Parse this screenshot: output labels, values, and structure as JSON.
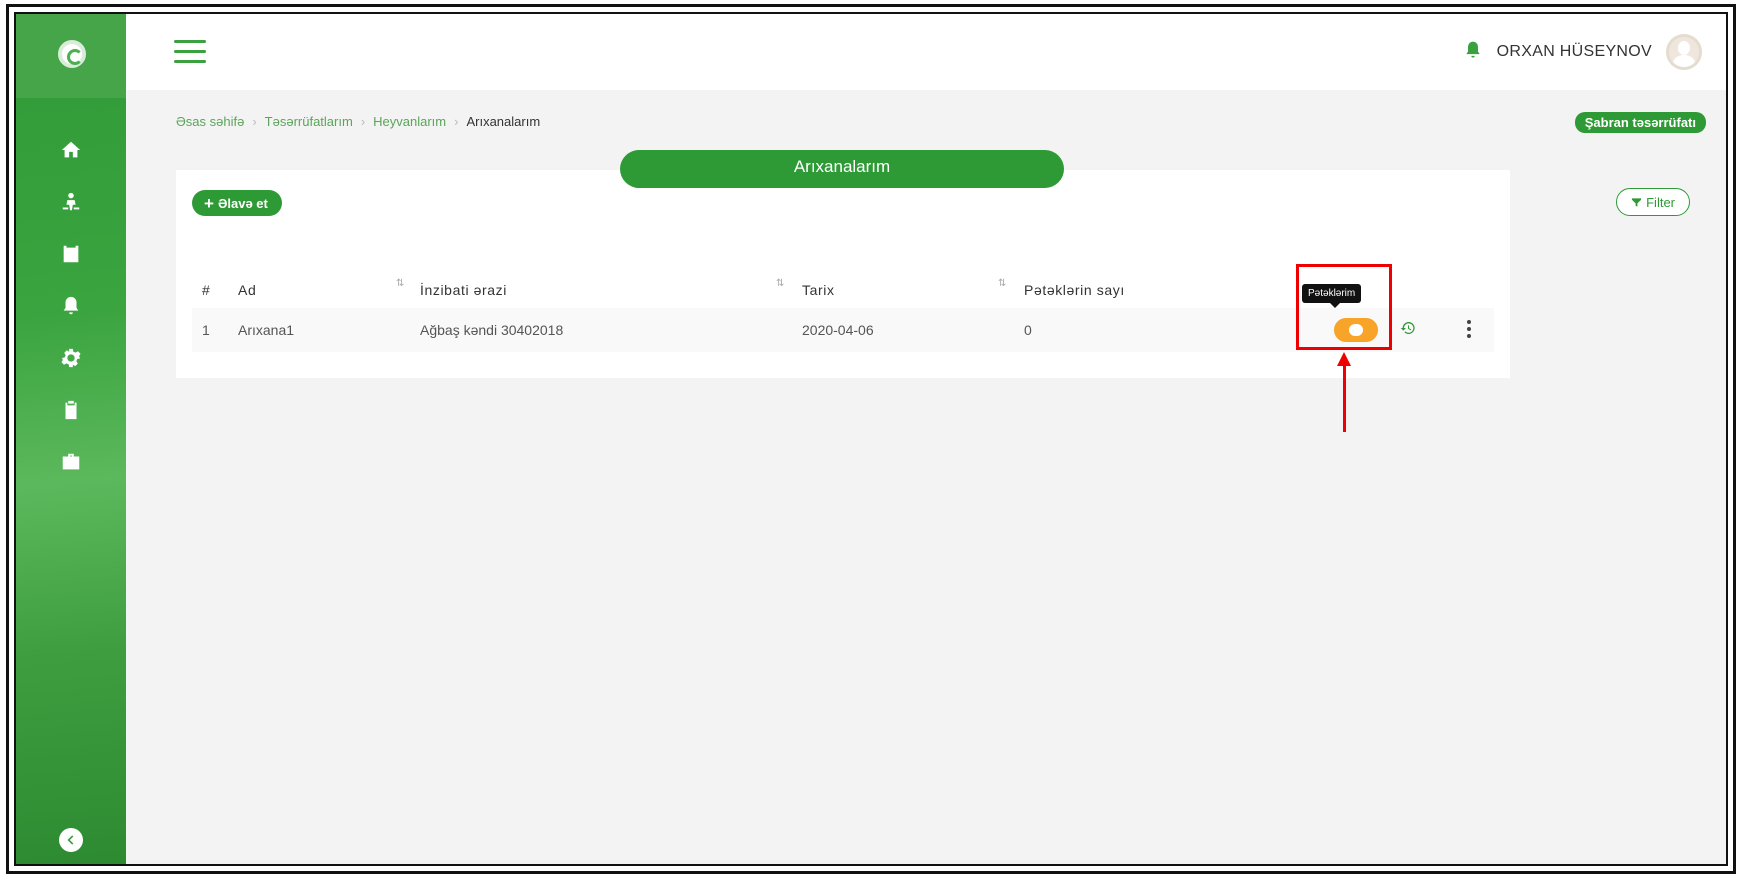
{
  "header": {
    "user_name": "ORXAN HÜSEYNOV"
  },
  "breadcrumb": {
    "items": [
      "Əsas səhifə",
      "Təsərrüfatlarım",
      "Heyvanlarım"
    ],
    "current": "Arıxanalarım"
  },
  "farm_badge": "Şabran təsərrüfatı",
  "page_title": "Arıxanalarım",
  "toolbar": {
    "add_label": "Əlavə et",
    "filter_label": "Filter"
  },
  "table": {
    "columns": [
      "#",
      "Ad",
      "İnzibati ərazi",
      "Tarix",
      "Pətəklərin sayı"
    ],
    "rows": [
      {
        "num": "1",
        "ad": "Arıxana1",
        "erazi": "Ağbaş kəndi 30402018",
        "tarix": "2020-04-06",
        "say": "0"
      }
    ]
  },
  "tooltip": "Pətəklərim",
  "colors": {
    "primary": "#2e9a35",
    "action_orange": "#f7a428",
    "annotation": "#e00000"
  },
  "sidebar_icons": [
    "home-icon",
    "farmer-icon",
    "calendar-icon",
    "bell-icon",
    "gear-icon",
    "clipboard-icon",
    "briefcase-icon"
  ]
}
